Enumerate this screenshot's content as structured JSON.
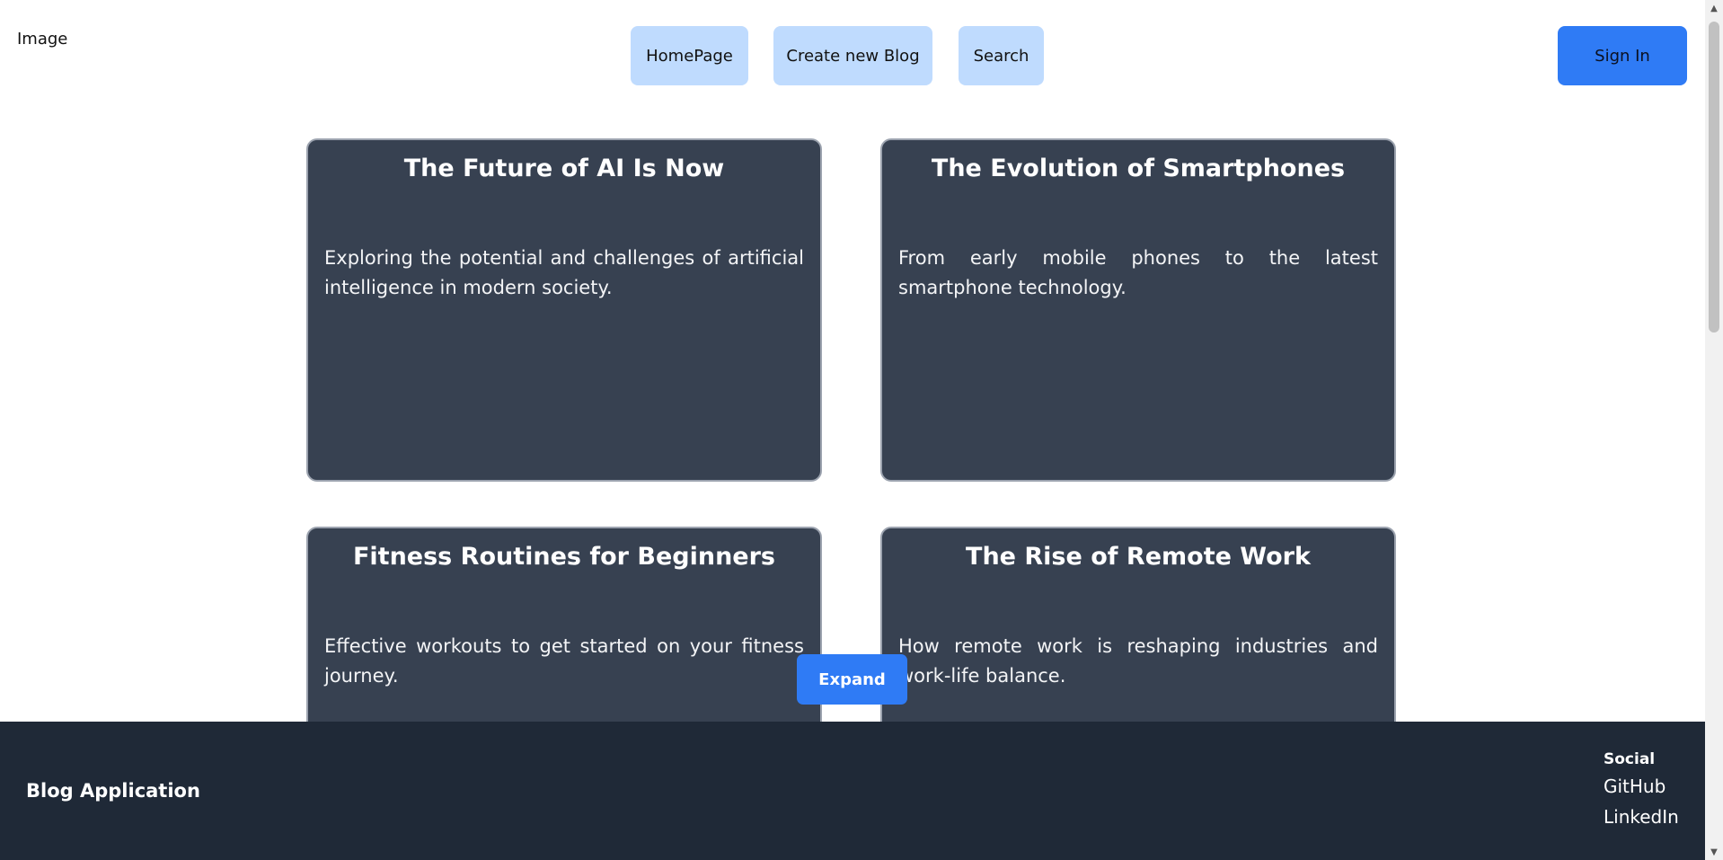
{
  "header": {
    "logo_alt": "Image",
    "nav": {
      "home": "HomePage",
      "create": "Create new Blog",
      "search": "Search"
    },
    "signin": "Sign In"
  },
  "cards": [
    {
      "title": "The Future of AI Is Now",
      "desc": "Exploring the potential and challenges of artificial intelligence in modern society."
    },
    {
      "title": "The Evolution of Smartphones",
      "desc": "From early mobile phones to the latest smartphone technology."
    },
    {
      "title": "Fitness Routines for Beginners",
      "desc": "Effective workouts to get started on your fitness journey."
    },
    {
      "title": "The Rise of Remote Work",
      "desc": "How remote work is reshaping industries and work-life balance."
    }
  ],
  "expand_label": "Expand",
  "footer": {
    "brand": "Blog Application",
    "social_heading": "Social",
    "links": [
      "GitHub",
      "LinkedIn"
    ]
  },
  "colors": {
    "nav_button": "#bfdbfe",
    "accent": "#2f7bf5",
    "card_bg": "#374151",
    "footer_bg": "#1f2937"
  },
  "icons": {
    "scroll_up": "triangle-up-icon",
    "scroll_down": "triangle-down-icon"
  }
}
